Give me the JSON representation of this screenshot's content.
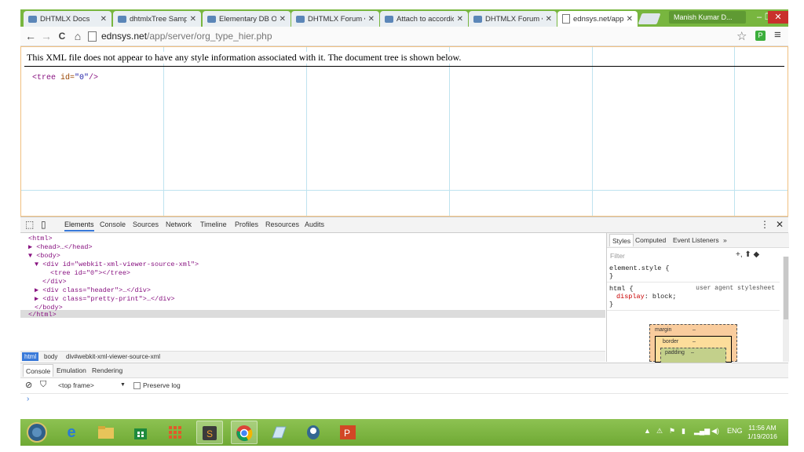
{
  "tabs": [
    {
      "label": "DHTMLX Docs",
      "icon": "dhtmlx-icon"
    },
    {
      "label": "dhtmlxTree Sample",
      "icon": "dhx-icon"
    },
    {
      "label": "Elementary DB Ope",
      "icon": "dhtmlx-icon"
    },
    {
      "label": "DHTMLX Forum • d",
      "icon": "dhx-icon"
    },
    {
      "label": "Attach to accordio",
      "icon": "dhx-icon"
    },
    {
      "label": "DHTMLX Forum • F",
      "icon": "dhx-icon"
    },
    {
      "label": "ednsys.net/app/ser",
      "icon": "page-icon",
      "active": true
    }
  ],
  "tab_close": "✕",
  "user_name": "Manish Kumar D...",
  "window_controls": {
    "minimize": "–",
    "restore": "❐",
    "close": "✕"
  },
  "nav": {
    "back": "←",
    "forward": "→",
    "reload": "C",
    "home": "⌂"
  },
  "url": {
    "host": "ednsys.net",
    "path": "/app/server/org_type_hier.php"
  },
  "page": {
    "notice": "This XML file does not appear to have any style information associated with it. The document tree is shown below.",
    "xml": {
      "open": "<tree",
      "attr": " id=",
      "val": "\"0\"",
      "close": "/>"
    }
  },
  "devtools": {
    "tabs": [
      "Elements",
      "Console",
      "Sources",
      "Network",
      "Timeline",
      "Profiles",
      "Resources",
      "Audits"
    ],
    "active_tab": "Elements",
    "tree": [
      {
        "text": "<html>"
      },
      {
        "text": "▶ <head>…</head>"
      },
      {
        "text": "▼ <body>"
      },
      {
        "text": "▼ <div id=\"webkit-xml-viewer-source-xml\">"
      },
      {
        "text": "<tree id=\"0\"></tree>"
      },
      {
        "text": "</div>"
      },
      {
        "text": "▶ <div class=\"header\">…</div>"
      },
      {
        "text": "▶ <div class=\"pretty-print\">…</div>"
      },
      {
        "text": "</body>"
      },
      {
        "text": "</html>"
      }
    ],
    "breadcrumbs": [
      "html",
      "body",
      "div#webkit-xml-viewer-source-xml"
    ],
    "styles_tabs": [
      "Styles",
      "Computed",
      "Event Listeners",
      "»"
    ],
    "filter_placeholder": "Filter",
    "style_rules": {
      "element_style": "element.style {",
      "element_close": "}",
      "html_selector": "html {",
      "ua_label": "user agent stylesheet",
      "prop": "display",
      "value": ": block;",
      "html_close": "}"
    },
    "box_model": {
      "margin": "margin",
      "margin_val": "–",
      "border": "border",
      "border_val": "–",
      "padding": "padding",
      "padding_val": "–"
    },
    "drawer_tabs": [
      "Console",
      "Emulation",
      "Rendering"
    ],
    "console": {
      "frame": "<top frame>",
      "dropdown": "▼",
      "preserve_log": "Preserve log",
      "prompt": "›"
    }
  },
  "taskbar": {
    "clock_time": "11:56 AM",
    "clock_date": "1/19/2016",
    "lang": "ENG"
  }
}
